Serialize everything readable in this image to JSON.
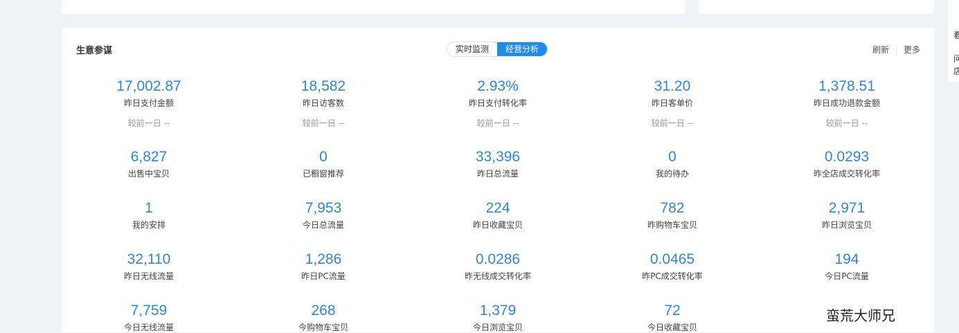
{
  "card": {
    "title": "生意参谋",
    "tabs": [
      {
        "label": "实时监测",
        "active": false
      },
      {
        "label": "经营分析",
        "active": true
      }
    ],
    "refresh_label": "刷新",
    "more_label": "更多"
  },
  "side_panel": {
    "chars": [
      "看",
      "问",
      "店"
    ]
  },
  "colors": {
    "accent": "#1f8ceb",
    "value": "#2e87d9",
    "background": "#f0f1f5"
  },
  "metrics": [
    {
      "value": "17,002.87",
      "label": "昨日支付金额",
      "compare": "较前一日 --"
    },
    {
      "value": "18,582",
      "label": "昨日访客数",
      "compare": "较前一日 --"
    },
    {
      "value": "2.93%",
      "label": "昨日支付转化率",
      "compare": "较前一日 --"
    },
    {
      "value": "31.20",
      "label": "昨日客单价",
      "compare": "较前一日 --"
    },
    {
      "value": "1,378.51",
      "label": "昨日成功退款金额",
      "compare": "较前一日 --"
    },
    {
      "value": "6,827",
      "label": "出售中宝贝"
    },
    {
      "value": "0",
      "label": "已橱窗推荐"
    },
    {
      "value": "33,396",
      "label": "昨日总流量"
    },
    {
      "value": "0",
      "label": "我的待办"
    },
    {
      "value": "0.0293",
      "label": "昨全店成交转化率"
    },
    {
      "value": "1",
      "label": "我的安排"
    },
    {
      "value": "7,953",
      "label": "今日总流量"
    },
    {
      "value": "224",
      "label": "昨日收藏宝贝"
    },
    {
      "value": "782",
      "label": "昨购物车宝贝"
    },
    {
      "value": "2,971",
      "label": "昨日浏览宝贝"
    },
    {
      "value": "32,110",
      "label": "昨日无线流量"
    },
    {
      "value": "1,286",
      "label": "昨日PC流量"
    },
    {
      "value": "0.0286",
      "label": "昨无线成交转化率"
    },
    {
      "value": "0.0465",
      "label": "昨PC成交转化率"
    },
    {
      "value": "194",
      "label": "今日PC流量"
    },
    {
      "value": "7,759",
      "label": "今日无线流量"
    },
    {
      "value": "268",
      "label": "今购物车宝贝"
    },
    {
      "value": "1,379",
      "label": "今日浏览宝贝"
    },
    {
      "value": "72",
      "label": "今日收藏宝贝"
    }
  ],
  "watermark": "蛮荒大师兄"
}
